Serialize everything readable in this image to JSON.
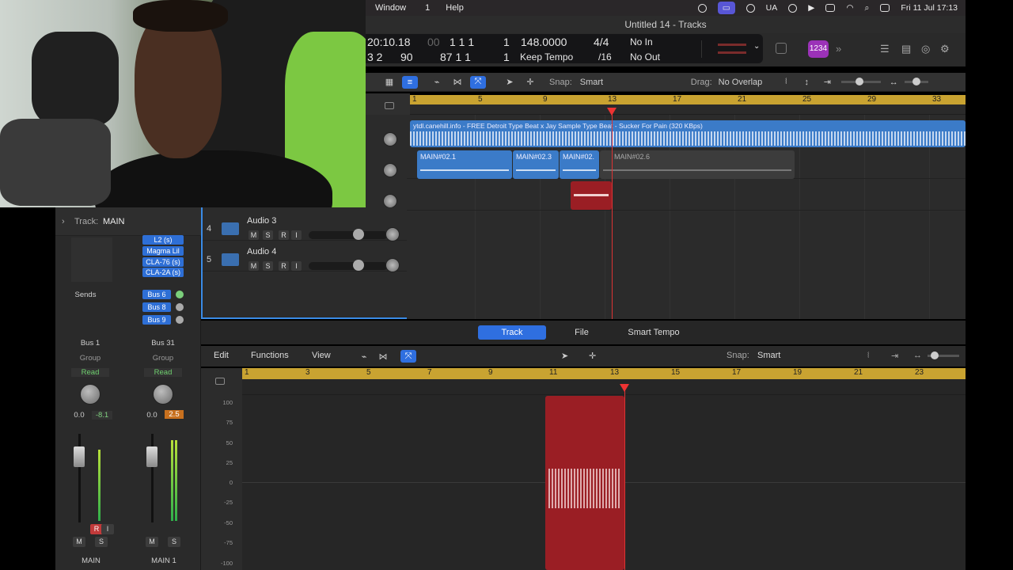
{
  "menubar": {
    "items": [
      "Window",
      "1",
      "Help"
    ],
    "right": {
      "lang": "UA",
      "datetime": "Fri 11 Jul  17:13"
    }
  },
  "window": {
    "title": "Untitled 14 - Tracks"
  },
  "lcd": {
    "time": "20:10.18",
    "time_dim": "00",
    "bars_top": "1  1  1",
    "beat_top": "1",
    "tempo": "148.0000",
    "signature": "4/4",
    "in_label": "No In",
    "row2_a": "3  2",
    "row2_b": "90",
    "row2_c": "87  1  1",
    "row2_d": "1",
    "tempo_mode": "Keep Tempo",
    "division": "/16",
    "out_label": "No Out",
    "badge": "1234"
  },
  "toolbar": {
    "snap_label": "Snap:",
    "snap_value": "Smart",
    "drag_label": "Drag:",
    "drag_value": "No Overlap"
  },
  "ruler_top": [
    "1",
    "5",
    "9",
    "13",
    "17",
    "21",
    "25",
    "29",
    "33"
  ],
  "regions": {
    "top_region": "ytdl.canehill.info - FREE Detroit Type Beat x Jay Sample Type Beat - Sucker For Pain (320 KBps)",
    "main1": "MAIN#02.1",
    "main3": "MAIN#02.3",
    "main2": "MAIN#02.",
    "main6": "MAIN#02.6"
  },
  "inspector": {
    "track_label": "Track:",
    "track_name": "MAIN",
    "plugins": [
      "L2 (s)",
      "Magma Lil",
      "CLA-76 (s)",
      "CLA-2A (s)"
    ],
    "sends_label": "Sends",
    "buses": [
      "Bus 6",
      "Bus 8",
      "Bus 9"
    ],
    "ch1": {
      "io": "Bus 1",
      "group": "Group",
      "auto": "Read",
      "vol": "0.0",
      "peak": "-8.1",
      "name": "MAIN"
    },
    "ch2": {
      "io": "Bus 31",
      "group": "Group",
      "auto": "Read",
      "vol": "0.0",
      "peak": "2.5",
      "name": "MAIN 1"
    },
    "btn_r": "R",
    "btn_i": "I",
    "btn_m": "M",
    "btn_s": "S"
  },
  "tracks": [
    {
      "num": "4",
      "name": "Audio 3"
    },
    {
      "num": "5",
      "name": "Audio 4"
    }
  ],
  "track_buttons": [
    "M",
    "S",
    "R",
    "I"
  ],
  "editor": {
    "tabs": [
      "Track",
      "File",
      "Smart Tempo"
    ],
    "menus": [
      "Edit",
      "Functions",
      "View"
    ],
    "snap_label": "Snap:",
    "snap_value": "Smart",
    "ruler": [
      "1",
      "3",
      "5",
      "7",
      "9",
      "11",
      "13",
      "15",
      "17",
      "19",
      "21",
      "23"
    ],
    "yaxis": [
      "100",
      "75",
      "50",
      "25",
      "0",
      "-25",
      "-50",
      "-75",
      "-100"
    ]
  },
  "colors": {
    "accent": "#2f6fe0",
    "ruler": "#c9a331",
    "region_red": "#9a1e24",
    "region_blue": "#3b7bc8"
  }
}
